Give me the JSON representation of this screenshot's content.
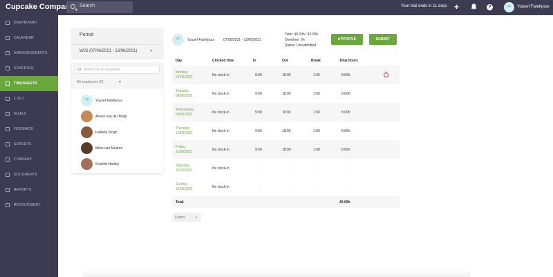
{
  "topbar": {
    "brand": "Cupcake Company",
    "search_placeholder": "Search",
    "trial": "Your trial ends in 11 days",
    "user_initials": "YF",
    "user_name": "Yousef Fatehpour"
  },
  "sidebar": {
    "items": [
      {
        "label": "DASHBOARD"
      },
      {
        "label": "CALENDAR"
      },
      {
        "label": "ANNOUNCEMENTS"
      },
      {
        "label": "SCHEDULE"
      },
      {
        "label": "TIMESHEETS",
        "active": true
      },
      {
        "label": "1-10-1"
      },
      {
        "label": "GOALS"
      },
      {
        "label": "FEEDBACK"
      },
      {
        "label": "SURVEYS"
      },
      {
        "label": "COMPANY"
      },
      {
        "label": "DOCUMENTS"
      },
      {
        "label": "REPORTS"
      },
      {
        "label": "RECRUITMENT"
      }
    ]
  },
  "period": {
    "title": "Period",
    "value": "W23 (07/06/2021 - 13/06/2021)"
  },
  "employees": {
    "search_placeholder": "Search for an employee",
    "filter": "All employees (5)",
    "list": [
      {
        "name": "Yousef Fatehpour",
        "initials": "YF",
        "color": "#d5eff0"
      },
      {
        "name": "Ahsen van der Burgt",
        "initials": "",
        "color": "#c48a57"
      },
      {
        "name": "Isabella Singh",
        "initials": "",
        "color": "#8a5a3c"
      },
      {
        "name": "Miles van Maaren",
        "initials": "",
        "color": "#5a3a2a"
      },
      {
        "name": "Scarlett Hartley",
        "initials": "",
        "color": "#a0705a"
      }
    ]
  },
  "timesheet": {
    "user_initials": "YF",
    "user_name": "Yousef Fatehpour",
    "range": "07/06/2021 - 13/06/2021",
    "total": "Total: 40.00h / 40.00h",
    "overtime": "Overtime: 0h",
    "status": "Status: Unsubmitted",
    "approve_label": "APPROVE",
    "submit_label": "SUBMIT",
    "headers": {
      "day": "Day",
      "clocked": "Clocked time",
      "in": "In",
      "out": "Out",
      "break": "Break",
      "total": "Total hours"
    },
    "rows": [
      {
        "weekday": "Monday",
        "date": "07/06/2021",
        "clocked": "No clock-in",
        "in": "9:00",
        "out": "18:00",
        "break": "1:00",
        "total": "8.00h"
      },
      {
        "weekday": "Tuesday",
        "date": "08/06/2021",
        "clocked": "No clock-in",
        "in": "9:00",
        "out": "18:00",
        "break": "1:00",
        "total": "8.00h"
      },
      {
        "weekday": "Wednesday",
        "date": "09/06/2021",
        "clocked": "No clock-in",
        "in": "9:00",
        "out": "18:00",
        "break": "1:00",
        "total": "8.00h"
      },
      {
        "weekday": "Thursday",
        "date": "10/06/2021",
        "clocked": "No clock-in",
        "in": "9:00",
        "out": "18:00",
        "break": "1:00",
        "total": "8.00h"
      },
      {
        "weekday": "Friday",
        "date": "11/06/2021",
        "clocked": "No clock-in",
        "in": "9:00",
        "out": "18:00",
        "break": "1:00",
        "total": "8.00h"
      },
      {
        "weekday": "Saturday",
        "date": "12/06/2021",
        "clocked": "No clock-in",
        "in": "-",
        "out": "-",
        "break": "-",
        "total": "-"
      },
      {
        "weekday": "Sunday",
        "date": "13/06/2021",
        "clocked": "No clock-in",
        "in": "-",
        "out": "-",
        "break": "-",
        "total": "-"
      }
    ],
    "footer_label": "Total",
    "footer_total": "40.00h",
    "export_label": "Export"
  },
  "colors": {
    "accent": "#6aa83c",
    "sidebar": "#3c3b52",
    "danger": "#d9362b"
  }
}
